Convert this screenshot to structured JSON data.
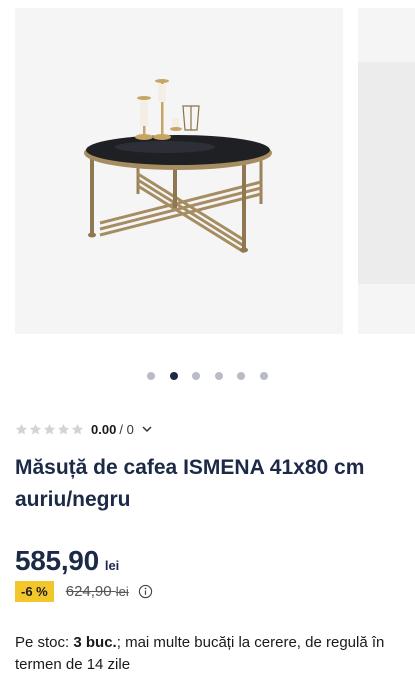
{
  "gallery": {
    "slide_count": 6,
    "active_index": 1,
    "product_image": "round-coffee-table-black-glass-gold-frame"
  },
  "rating": {
    "stars_filled": 0,
    "stars_total": 5,
    "score": "0.00",
    "separator": "/",
    "count": "0",
    "icon": "chevron-down-icon"
  },
  "product": {
    "title": "Măsuță de cafea ISMENA 41x80 cm auriu/negru"
  },
  "price": {
    "current": "585,90",
    "currency": "lei",
    "discount": "-6 %",
    "old": "624,90",
    "old_currency": "lei",
    "info_icon": "info-icon"
  },
  "stock": {
    "label": "Pe stoc:",
    "qty": "3 buc.",
    "text": "; mai multe bucăți la cerere, de regulă în termen de 14 zile"
  },
  "colors": {
    "title": "#1c2a47",
    "badge": "#f3c72c",
    "dot_active": "#1d2a44",
    "dot_inactive": "#b8bcc4"
  }
}
